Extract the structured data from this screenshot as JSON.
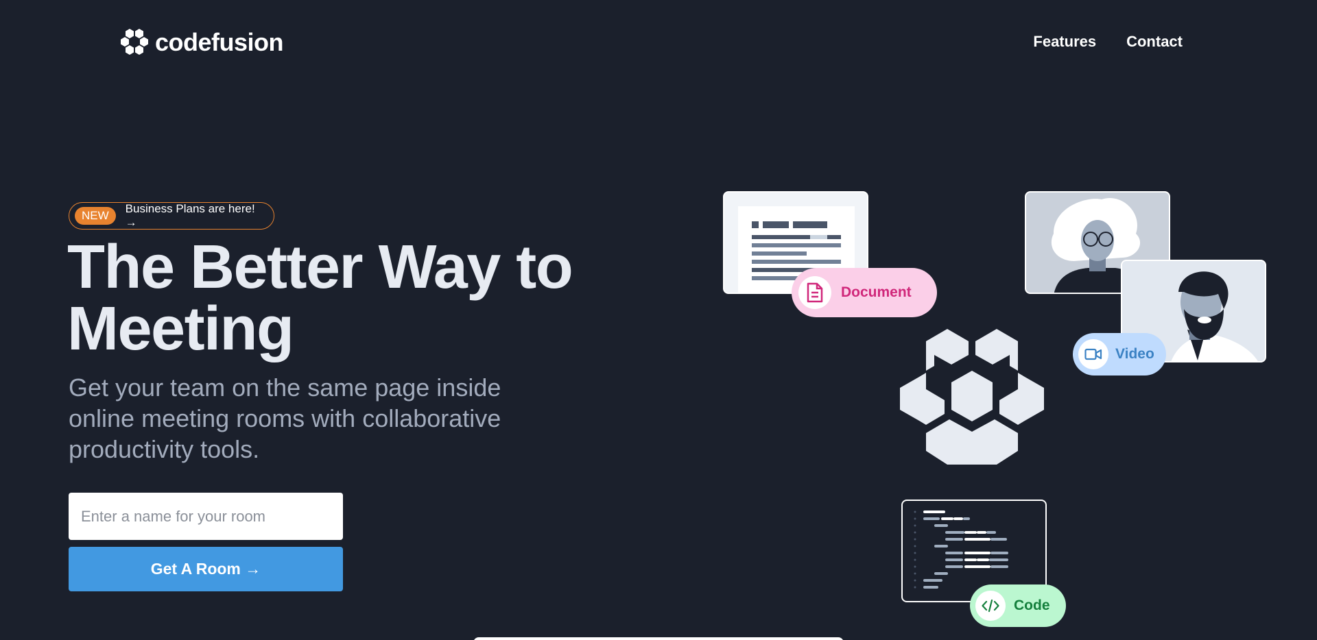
{
  "brand": {
    "name": "codefusion"
  },
  "nav": {
    "items": [
      "Features",
      "Contact"
    ]
  },
  "hero": {
    "badge_tag": "NEW",
    "badge_text": "Business Plans are here! →",
    "title": "The Better Way to Meeting",
    "subtitle": "Get your team on the same page inside online meeting rooms with collaborative productivity tools.",
    "room_placeholder": "Enter a name for your room",
    "cta_label": "Get A Room →"
  },
  "illustration": {
    "pills": {
      "document": "Document",
      "video": "Video",
      "code": "Code"
    }
  },
  "colors": {
    "background": "#1b202c",
    "accent": "#4299e1",
    "badge": "#e8832f",
    "document_pill": "#fbcfe8",
    "video_pill": "#bfdbfe",
    "code_pill": "#bbf7d0"
  }
}
